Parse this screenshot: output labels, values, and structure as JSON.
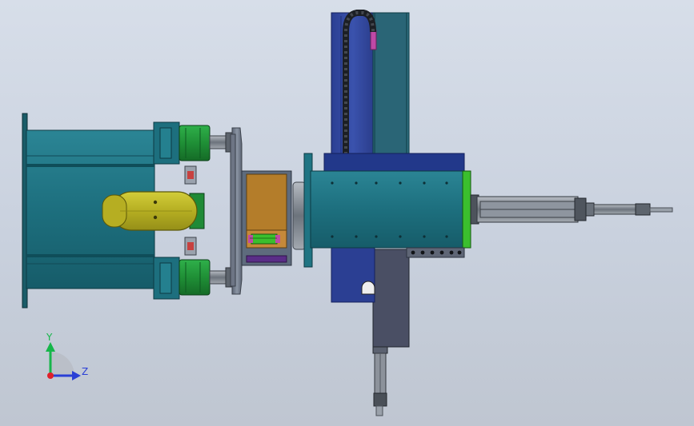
{
  "triad": {
    "y_label": "Y",
    "z_label": "Z",
    "colors": {
      "y": "#16b64a",
      "z": "#2a3fd6",
      "x": "#e0202a"
    }
  },
  "colors": {
    "teal_body": "#1d6f7e",
    "teal_dark": "#0f4d59",
    "motor_green": "#1f9a3a",
    "slide_blue": "#3349a0",
    "slide_blue_dark": "#1e2f75",
    "yellow_carriage": "#b8b327",
    "orange_block": "#b8812c",
    "gray_plate": "#7d8797",
    "spindle_gray": "#8a9098",
    "accent_green": "#3bbf2e",
    "magenta": "#c049a6"
  }
}
